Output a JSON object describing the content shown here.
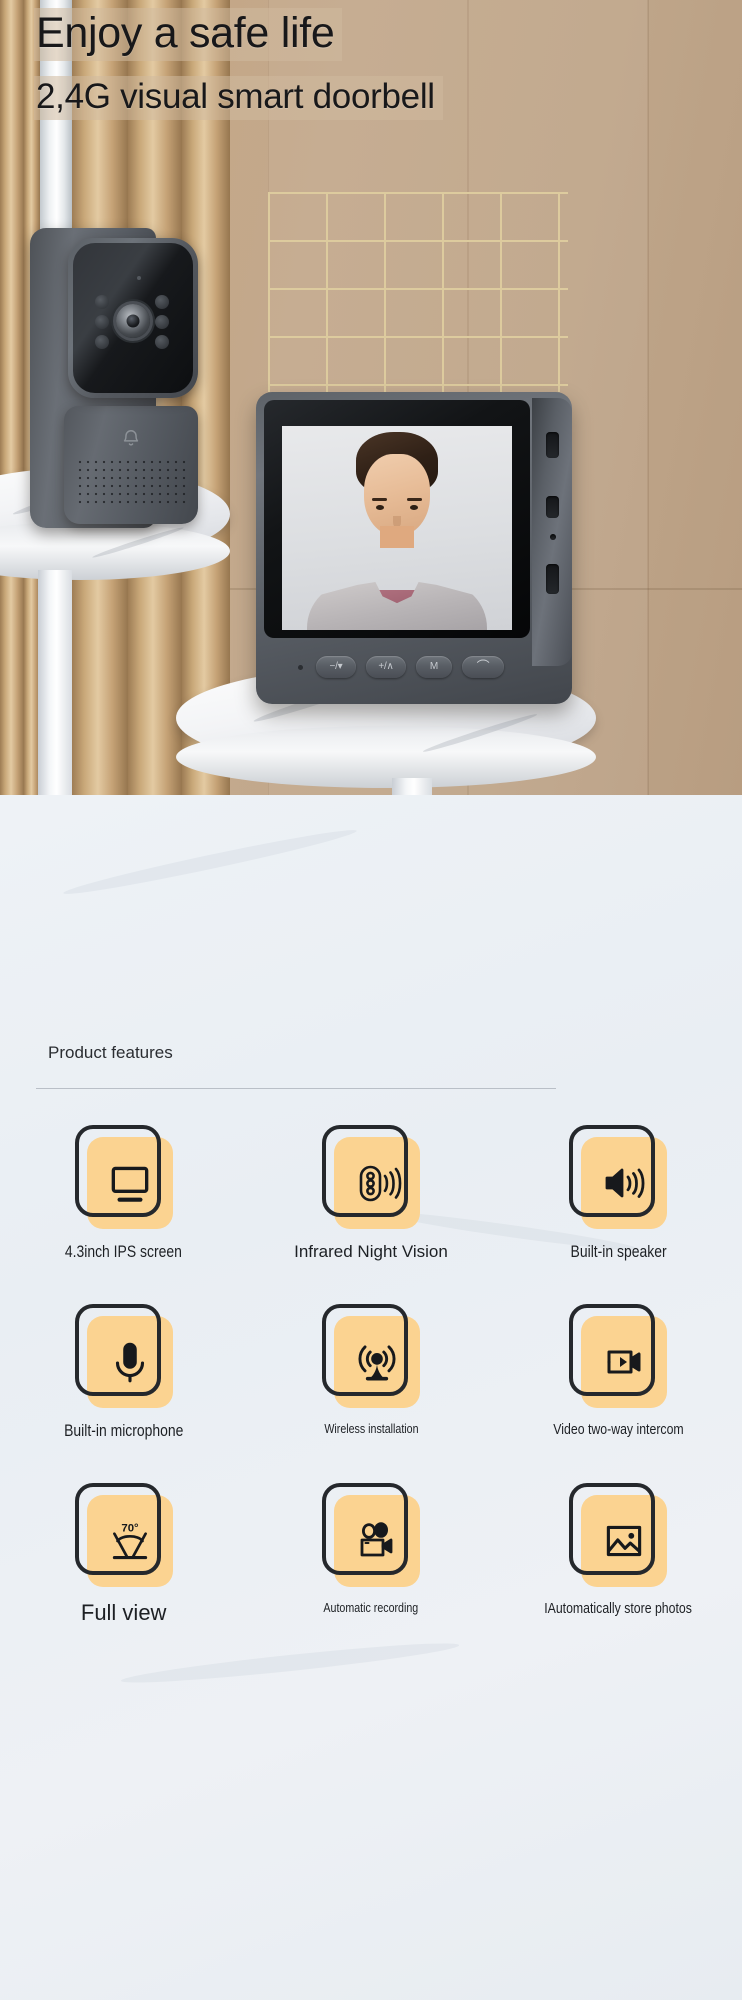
{
  "hero": {
    "title": "Enjoy a safe life",
    "subtitle": "2,4G visual smart doorbell",
    "accent_wall": "#c3a688",
    "gold_grid_color": "#ddcb9e",
    "device_body_color": "#5a5f66"
  },
  "monitor": {
    "buttons": [
      {
        "name": "minus-down-button",
        "label": "−/▾"
      },
      {
        "name": "plus-up-button",
        "label": "+/∧"
      },
      {
        "name": "menu-button",
        "label": "M"
      },
      {
        "name": "answer-call-button",
        "label": "⌒"
      }
    ],
    "screen_subject": "smiling man video call preview"
  },
  "features_section": {
    "heading": "Product features",
    "tile_fill_color": "#fbd391",
    "tile_outline_color": "#25282c",
    "rows": [
      [
        {
          "icon": "monitor-screen-icon",
          "label": "4.3inch IPS screen",
          "label_style": "condensed",
          "label_size": 17
        },
        {
          "icon": "infrared-night-vision-icon",
          "label": "Infrared Night Vision",
          "label_style": "normal",
          "label_size": 17
        },
        {
          "icon": "speaker-volume-icon",
          "label": "Built-in speaker",
          "label_style": "condensed",
          "label_size": 17
        }
      ],
      [
        {
          "icon": "microphone-icon",
          "label": "Built-in microphone",
          "label_style": "condensed",
          "label_size": 17
        },
        {
          "icon": "wireless-signal-tower-icon",
          "label": "Wireless installation",
          "label_style": "condensed",
          "label_size": 13
        },
        {
          "icon": "video-intercom-icon",
          "label": "Video two-way intercom",
          "label_style": "condensed",
          "label_size": 15
        }
      ],
      [
        {
          "icon": "wide-angle-view-icon",
          "label": "Full view",
          "label_style": "normal",
          "label_size": 22,
          "badge": "70°"
        },
        {
          "icon": "movie-camera-icon",
          "label": "Automatic recording",
          "label_style": "condensed",
          "label_size": 13
        },
        {
          "icon": "photo-gallery-icon",
          "label": "IAutomatically store photos",
          "label_style": "condensed",
          "label_size": 15
        }
      ]
    ]
  }
}
